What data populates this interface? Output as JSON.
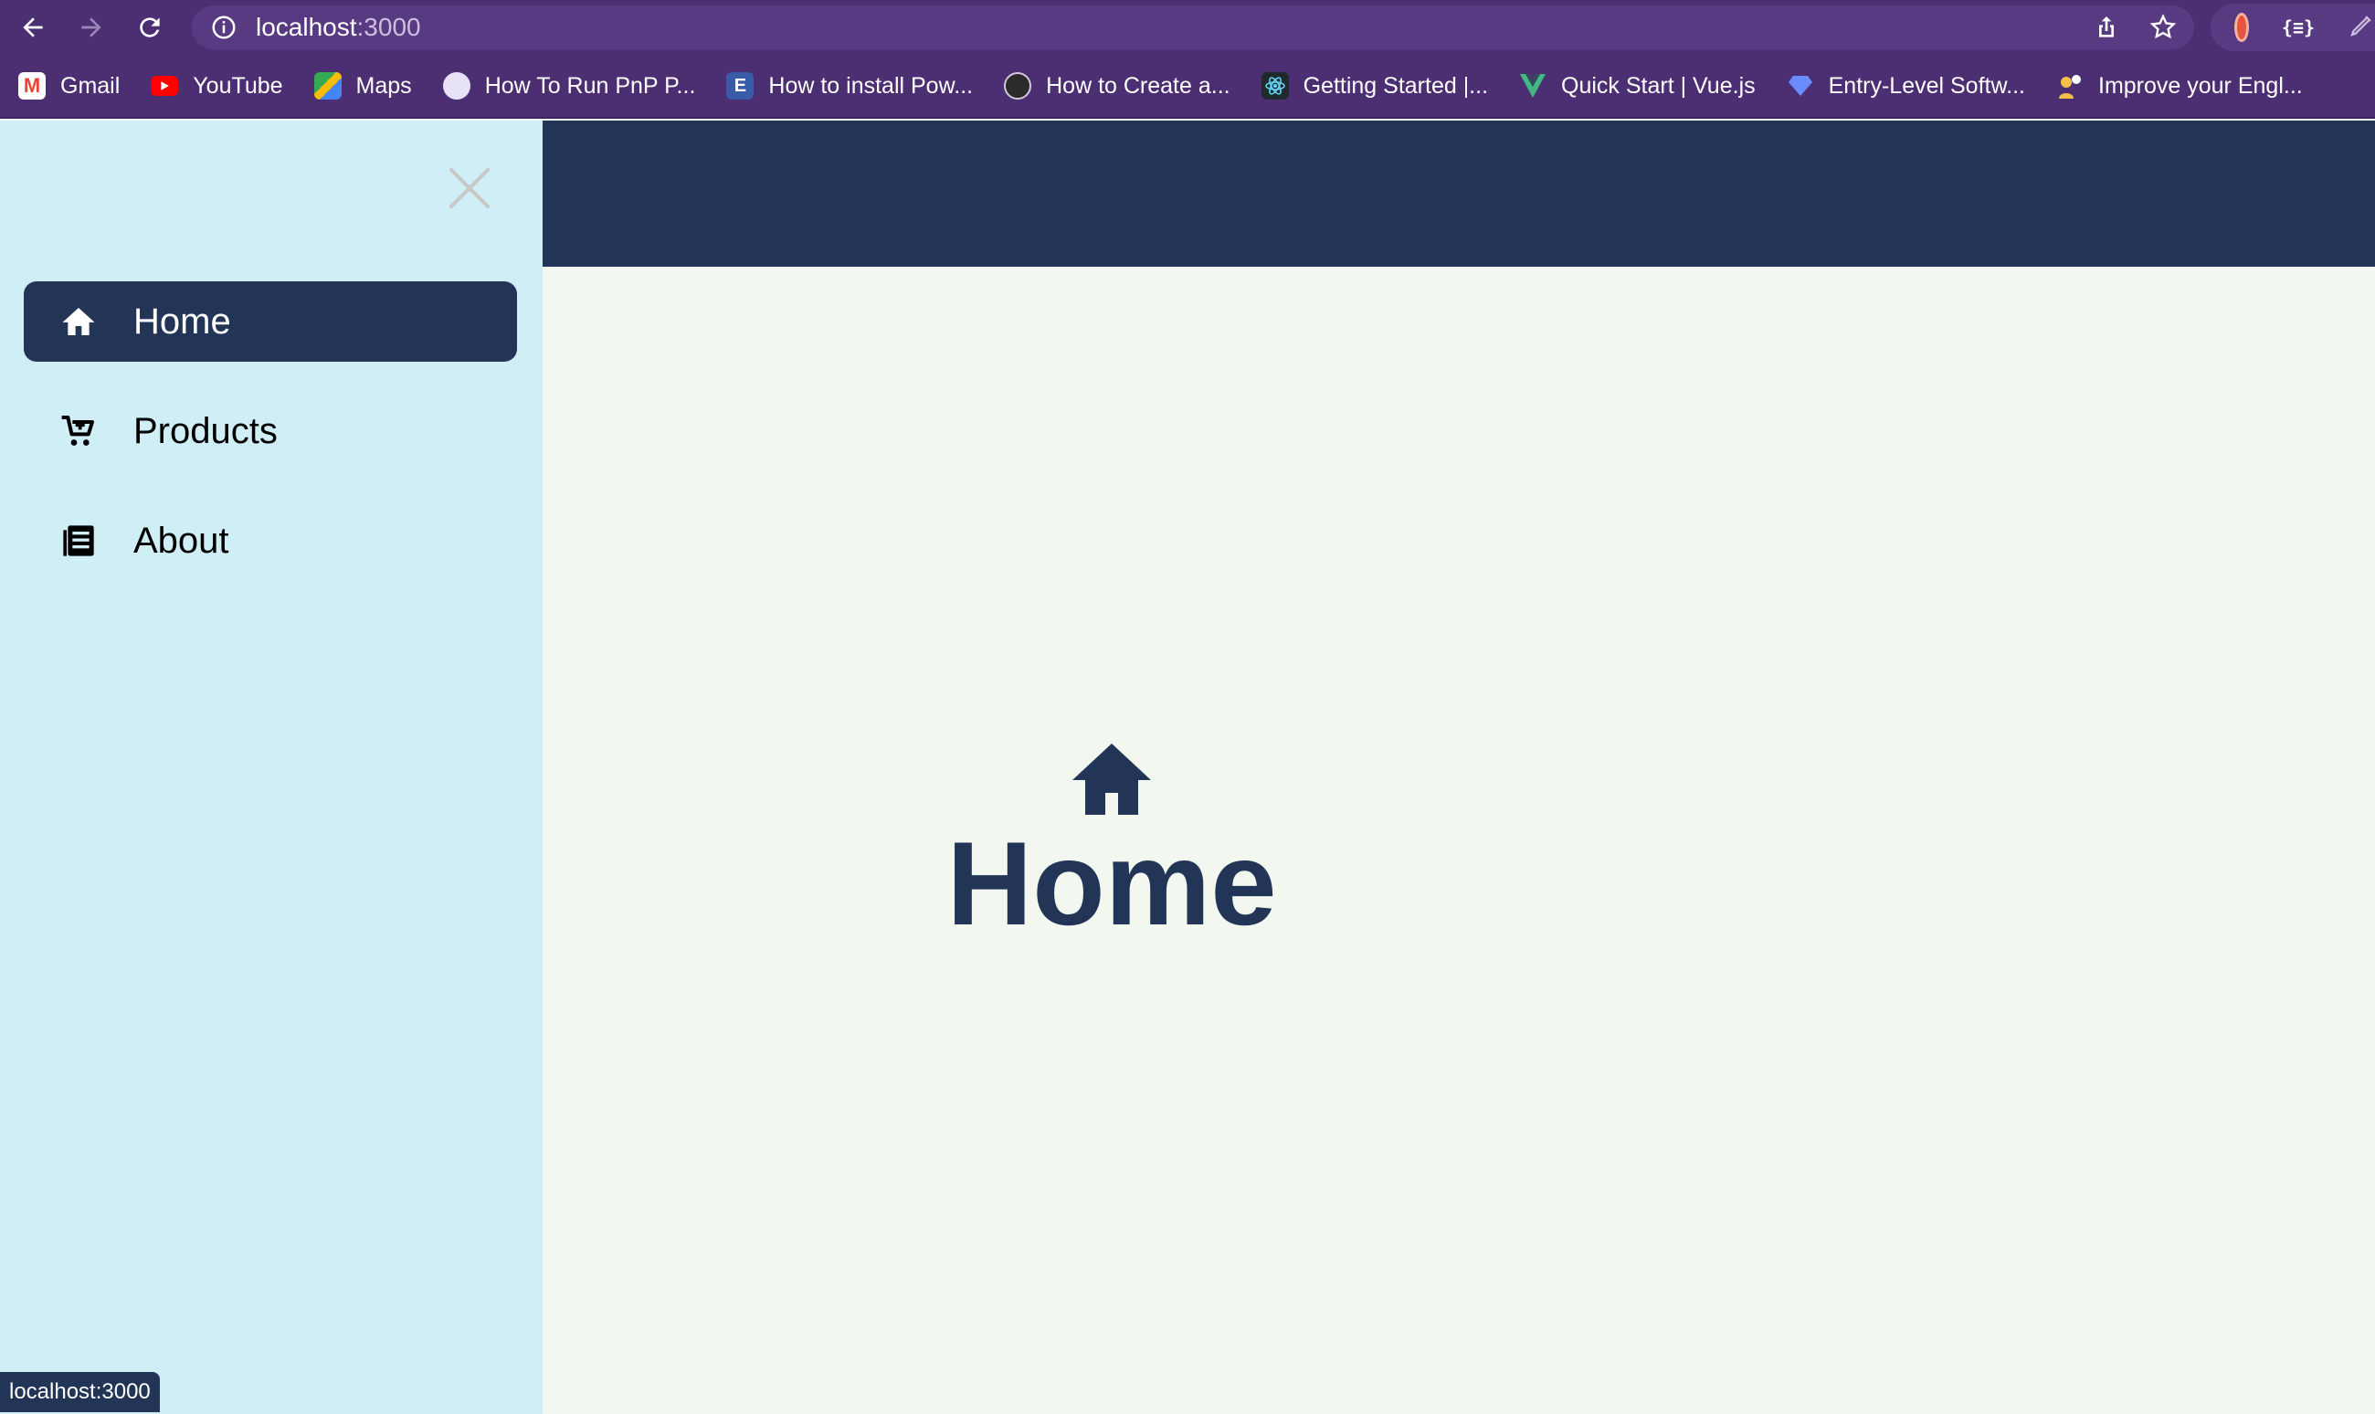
{
  "browser": {
    "url_host": "localhost",
    "url_port": ":3000",
    "bookmarks": [
      {
        "label": "Gmail",
        "icon": "gmail-icon",
        "color": "#ea4335"
      },
      {
        "label": "YouTube",
        "icon": "youtube-icon",
        "color": "#ff0000"
      },
      {
        "label": "Maps",
        "icon": "maps-icon",
        "color": "#34a853"
      },
      {
        "label": "How To Run PnP P...",
        "icon": "pnp-icon",
        "color": "#e8e2f6"
      },
      {
        "label": "How to install Pow...",
        "icon": "powershell-icon",
        "color": "#3a5ba8"
      },
      {
        "label": "How to Create a...",
        "icon": "avatar-icon",
        "color": "#2b2b2b"
      },
      {
        "label": "Getting Started |...",
        "icon": "react-icon",
        "color": "#61dafb"
      },
      {
        "label": "Quick Start | Vue.js",
        "icon": "vue-icon",
        "color": "#42b883"
      },
      {
        "label": "Entry-Level Softw...",
        "icon": "gem-icon",
        "color": "#6b8cff"
      },
      {
        "label": "Improve your Engl...",
        "icon": "people-icon",
        "color": "#f5c04a"
      }
    ]
  },
  "sidebar": {
    "items": [
      {
        "label": "Home",
        "icon": "home-icon",
        "active": true
      },
      {
        "label": "Products",
        "icon": "cart-icon",
        "active": false
      },
      {
        "label": "About",
        "icon": "list-icon",
        "active": false
      }
    ]
  },
  "main": {
    "title": "Home",
    "icon": "home-icon"
  },
  "status_bar": {
    "text": "localhost:3000"
  },
  "colors": {
    "brand_dark": "#223556",
    "sidebar_bg": "#d0eef6",
    "main_bg": "#f2f8ef",
    "chrome_bg": "#4b2f72"
  }
}
